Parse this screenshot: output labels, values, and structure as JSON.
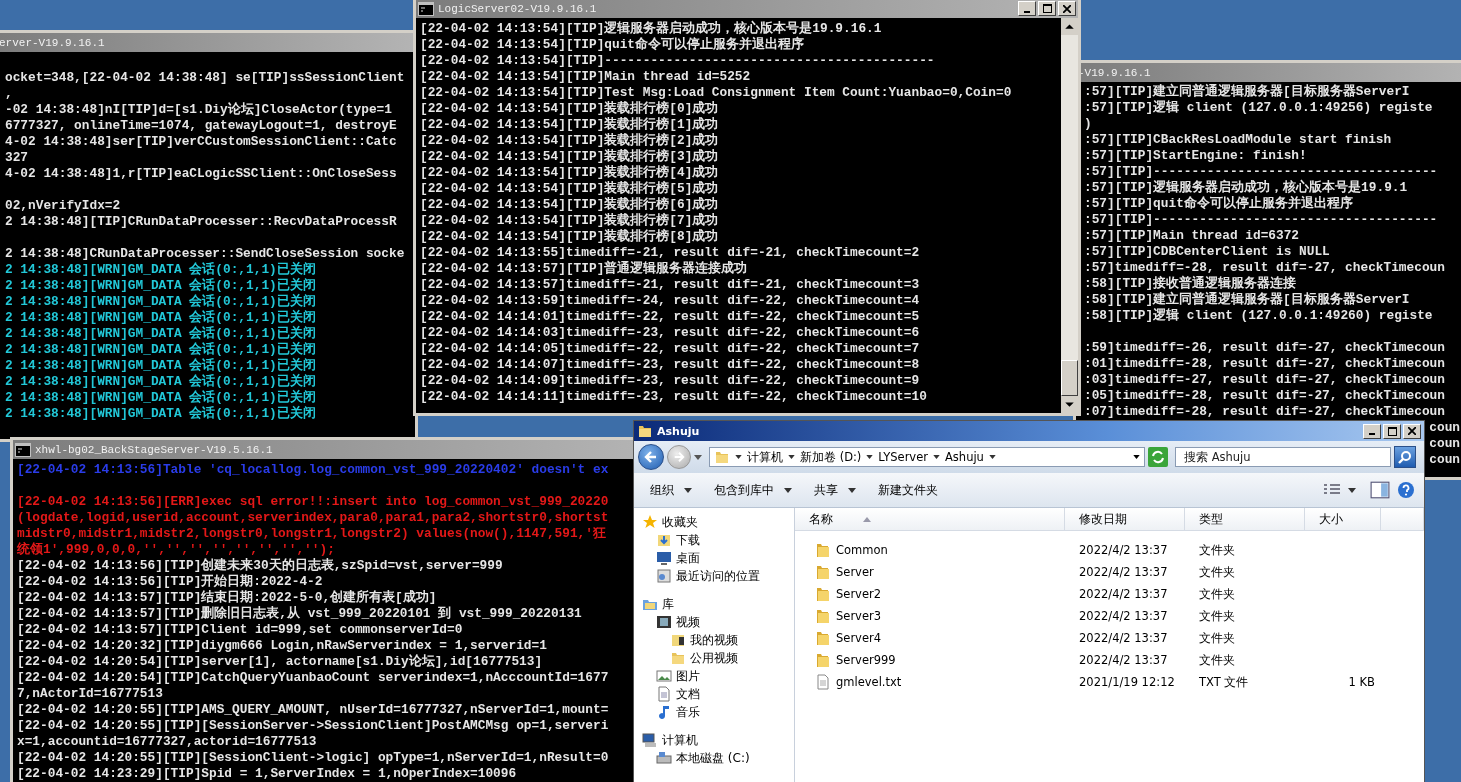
{
  "console_windows": [
    {
      "title": "erver-V19.9.16.1",
      "lines": [
        {
          "kind": "blank"
        },
        {
          "kind": "tip",
          "text": "ocket=348,[22-04-02 14:38:48] se[TIP]ssSessionClient"
        },
        {
          "kind": "tip",
          "text": ","
        },
        {
          "kind": "tip",
          "text": "-02 14:38:48]nI[TIP]d=[s1.Diy论坛]CloseActor(type=1"
        },
        {
          "kind": "tip",
          "text": "6777327, onlineTime=1074, gatewayLogout=1, destroyE"
        },
        {
          "kind": "tip",
          "text": "4-02 14:38:48]ser[TIP]verCCustomSessionClient::Catc"
        },
        {
          "kind": "tip",
          "text": "327"
        },
        {
          "kind": "tip",
          "text": "4-02 14:38:48]1,r[TIP]eaCLogicSSClient::OnCloseSess"
        },
        {
          "kind": "blank"
        },
        {
          "kind": "tip",
          "text": "02,nVerifyIdx=2"
        },
        {
          "kind": "tip",
          "text": "2 14:38:48][TIP]CRunDataProcesser::RecvDataProcessR"
        },
        {
          "kind": "blank"
        },
        {
          "kind": "tip",
          "text": "2 14:38:48]CRunDataProcesser::SendCloseSession socke"
        },
        {
          "kind": "warn",
          "text": "2 14:38:48][WRN]GM_DATA 会话(0:,1,1)已关闭"
        },
        {
          "kind": "warn",
          "text": "2 14:38:48][WRN]GM_DATA 会话(0:,1,1)已关闭"
        },
        {
          "kind": "warn",
          "text": "2 14:38:48][WRN]GM_DATA 会话(0:,1,1)已关闭"
        },
        {
          "kind": "warn",
          "text": "2 14:38:48][WRN]GM_DATA 会话(0:,1,1)已关闭"
        },
        {
          "kind": "warn",
          "text": "2 14:38:48][WRN]GM_DATA 会话(0:,1,1)已关闭"
        },
        {
          "kind": "warn",
          "text": "2 14:38:48][WRN]GM_DATA 会话(0:,1,1)已关闭"
        },
        {
          "kind": "warn",
          "text": "2 14:38:48][WRN]GM_DATA 会话(0:,1,1)已关闭"
        },
        {
          "kind": "warn",
          "text": "2 14:38:48][WRN]GM_DATA 会话(0:,1,1)已关闭"
        },
        {
          "kind": "warn",
          "text": "2 14:38:48][WRN]GM_DATA 会话(0:,1,1)已关闭"
        },
        {
          "kind": "warn",
          "text": "2 14:38:48][WRN]GM_DATA 会话(0:,1,1)已关闭"
        }
      ]
    },
    {
      "title": "-V19.9.16.1",
      "lines": [
        {
          "kind": "tip",
          "text": ":57][TIP]建立同普通逻辑服务器[目标服务器ServerI"
        },
        {
          "kind": "tip",
          "text": ":57][TIP]逻辑 client (127.0.0.1:49256) registe"
        },
        {
          "kind": "tip",
          "text": ")"
        },
        {
          "kind": "tip",
          "text": ":57][TIP]CBackResLoadModule start finish"
        },
        {
          "kind": "tip",
          "text": ":57][TIP]StartEngine: finish!"
        },
        {
          "kind": "tip",
          "text": ":57][TIP]-------------------------------------"
        },
        {
          "kind": "tip",
          "text": ":57][TIP]逻辑服务器启动成功，核心版本号是19.9.1"
        },
        {
          "kind": "tip",
          "text": ":57][TIP]quit命令可以停止服务并退出程序"
        },
        {
          "kind": "tip",
          "text": ":57][TIP]-------------------------------------"
        },
        {
          "kind": "tip",
          "text": ":57][TIP]Main thread id=6372"
        },
        {
          "kind": "tip",
          "text": ":57][TIP]CDBCenterClient is NULL"
        },
        {
          "kind": "tip",
          "text": ":57]timediff=-28, result dif=-27, checkTimecoun"
        },
        {
          "kind": "tip",
          "text": ":58][TIP]接收普通逻辑服务器连接"
        },
        {
          "kind": "tip",
          "text": ":58][TIP]建立同普通逻辑服务器[目标服务器ServerI"
        },
        {
          "kind": "tip",
          "text": ":58][TIP]逻辑 client (127.0.0.1:49260) registe"
        },
        {
          "kind": "blank"
        },
        {
          "kind": "tip",
          "text": ":59]timediff=-26, result dif=-27, checkTimecoun"
        },
        {
          "kind": "tip",
          "text": ":01]timediff=-28, result dif=-27, checkTimecoun"
        },
        {
          "kind": "tip",
          "text": ":03]timediff=-27, result dif=-27, checkTimecoun"
        },
        {
          "kind": "tip",
          "text": ":05]timediff=-28, result dif=-27, checkTimecoun"
        },
        {
          "kind": "tip",
          "text": ":07]timediff=-28, result dif=-27, checkTimecoun"
        },
        {
          "kind": "tail",
          "text": "coun"
        },
        {
          "kind": "tail",
          "text": "coun"
        },
        {
          "kind": "tail",
          "text": "coun"
        }
      ]
    },
    {
      "title": "LogicServer02-V19.9.16.1",
      "lines": [
        {
          "kind": "tip",
          "text": "[22-04-02 14:13:54][TIP]逻辑服务器启动成功，核心版本号是19.9.16.1"
        },
        {
          "kind": "tip",
          "text": "[22-04-02 14:13:54][TIP]quit命令可以停止服务并退出程序"
        },
        {
          "kind": "tip",
          "text": "[22-04-02 14:13:54][TIP]-------------------------------------------"
        },
        {
          "kind": "tip",
          "text": "[22-04-02 14:13:54][TIP]Main thread id=5252"
        },
        {
          "kind": "tip",
          "text": "[22-04-02 14:13:54][TIP]Test Msg:Load Consignment Item Count:Yuanbao=0,Coin=0"
        },
        {
          "kind": "tip",
          "text": "[22-04-02 14:13:54][TIP]装载排行榜[0]成功"
        },
        {
          "kind": "tip",
          "text": "[22-04-02 14:13:54][TIP]装载排行榜[1]成功"
        },
        {
          "kind": "tip",
          "text": "[22-04-02 14:13:54][TIP]装载排行榜[2]成功"
        },
        {
          "kind": "tip",
          "text": "[22-04-02 14:13:54][TIP]装载排行榜[3]成功"
        },
        {
          "kind": "tip",
          "text": "[22-04-02 14:13:54][TIP]装载排行榜[4]成功"
        },
        {
          "kind": "tip",
          "text": "[22-04-02 14:13:54][TIP]装载排行榜[5]成功"
        },
        {
          "kind": "tip",
          "text": "[22-04-02 14:13:54][TIP]装载排行榜[6]成功"
        },
        {
          "kind": "tip",
          "text": "[22-04-02 14:13:54][TIP]装载排行榜[7]成功"
        },
        {
          "kind": "tip",
          "text": "[22-04-02 14:13:54][TIP]装载排行榜[8]成功"
        },
        {
          "kind": "tip",
          "text": "[22-04-02 14:13:55]timediff=-21, result dif=-21, checkTimecount=2"
        },
        {
          "kind": "tip",
          "text": "[22-04-02 14:13:57][TIP]普通逻辑服务器连接成功"
        },
        {
          "kind": "tip",
          "text": "[22-04-02 14:13:57]timediff=-21, result dif=-21, checkTimecount=3"
        },
        {
          "kind": "tip",
          "text": "[22-04-02 14:13:59]timediff=-24, result dif=-22, checkTimecount=4"
        },
        {
          "kind": "tip",
          "text": "[22-04-02 14:14:01]timediff=-22, result dif=-22, checkTimecount=5"
        },
        {
          "kind": "tip",
          "text": "[22-04-02 14:14:03]timediff=-23, result dif=-22, checkTimecount=6"
        },
        {
          "kind": "tip",
          "text": "[22-04-02 14:14:05]timediff=-22, result dif=-22, checkTimecount=7"
        },
        {
          "kind": "tip",
          "text": "[22-04-02 14:14:07]timediff=-23, result dif=-22, checkTimecount=8"
        },
        {
          "kind": "tip",
          "text": "[22-04-02 14:14:09]timediff=-23, result dif=-22, checkTimecount=9"
        },
        {
          "kind": "tip",
          "text": "[22-04-02 14:14:11]timediff=-23, result dif=-22, checkTimecount=10"
        }
      ]
    },
    {
      "title": "xhwl-bg02_BackStageServer-V19.5.16.1",
      "lines": [
        {
          "kind": "sql",
          "text": "[22-04-02 14:13:56]Table 'cq_locallog.log_common_vst_999_20220402' doesn't ex"
        },
        {
          "kind": "blank"
        },
        {
          "kind": "error",
          "text": "[22-04-02 14:13:56][ERR]exec sql error!!:insert into log_common_vst_999_20220"
        },
        {
          "kind": "error",
          "text": "(logdate,logid,userid,account,serverindex,para0,para1,para2,shortstr0,shortst"
        },
        {
          "kind": "error",
          "text": "midstr0,midstr1,midstr2,longstr0,longstr1,longstr2) values(now(),1147,591,'狂"
        },
        {
          "kind": "error",
          "text": "统领1',999,0,0,0,'','','','','','','','');"
        },
        {
          "kind": "tip",
          "text": "[22-04-02 14:13:56][TIP]创建未来30天的日志表,szSpid=vst,server=999"
        },
        {
          "kind": "tip",
          "text": "[22-04-02 14:13:56][TIP]开始日期:2022-4-2"
        },
        {
          "kind": "tip",
          "text": "[22-04-02 14:13:57][TIP]结束日期:2022-5-0,创建所有表[成功]"
        },
        {
          "kind": "tip",
          "text": "[22-04-02 14:13:57][TIP]删除旧日志表,从 vst_999_20220101 到 vst_999_20220131"
        },
        {
          "kind": "tip",
          "text": "[22-04-02 14:13:57][TIP]Client id=999,set commonserverId=0"
        },
        {
          "kind": "tip",
          "text": "[22-04-02 14:20:32][TIP]diygm666 Login,nRawServerindex = 1,serverid=1"
        },
        {
          "kind": "tip",
          "text": "[22-04-02 14:20:54][TIP]server[1], actorname[s1.Diy论坛],id[16777513]"
        },
        {
          "kind": "tip",
          "text": "[22-04-02 14:20:54][TIP]CatchQueryYuanbaoCount serverindex=1,nAcccountId=1677"
        },
        {
          "kind": "tip",
          "text": "7,nActorId=16777513"
        },
        {
          "kind": "tip",
          "text": "[22-04-02 14:20:55][TIP]AMS_QUERY_AMOUNT, nUserId=16777327,nServerId=1,mount="
        },
        {
          "kind": "tip",
          "text": "[22-04-02 14:20:55][TIP][SessionServer->SessionClient]PostAMCMsg op=1,serveri"
        },
        {
          "kind": "tip",
          "text": "x=1,accountid=16777327,actorid=16777513"
        },
        {
          "kind": "tip",
          "text": "[22-04-02 14:20:55][TIP][SessionClient->logic] opType=1,nServerId=1,nResult=0"
        },
        {
          "kind": "tip",
          "text": "[22-04-02 14:23:29][TIP]Spid = 1,ServerIndex = 1,nOperIndex=10096"
        }
      ]
    }
  ],
  "explorer": {
    "title": "Ashuju",
    "address": [
      "计算机",
      "新加卷 (D:)",
      "LYServer",
      "Ashuju"
    ],
    "search": {
      "placeholder": "搜索 Ashuju"
    },
    "toolbar": [
      {
        "label": "组织",
        "dropdown": true
      },
      {
        "label": "包含到库中",
        "dropdown": true
      },
      {
        "label": "共享",
        "dropdown": true
      },
      {
        "label": "新建文件夹",
        "dropdown": false
      }
    ],
    "nav": [
      {
        "label": "收藏夹",
        "kind": "star",
        "children": [
          {
            "label": "下载",
            "kind": "download"
          },
          {
            "label": "桌面",
            "kind": "desktop"
          },
          {
            "label": "最近访问的位置",
            "kind": "recent"
          }
        ]
      },
      {
        "label": "库",
        "kind": "library",
        "children": [
          {
            "label": "视频",
            "kind": "video",
            "children": [
              {
                "label": "我的视频",
                "kind": "videofolder"
              },
              {
                "label": "公用视频",
                "kind": "folder"
              }
            ]
          },
          {
            "label": "图片",
            "kind": "picture"
          },
          {
            "label": "文档",
            "kind": "document"
          },
          {
            "label": "音乐",
            "kind": "music"
          }
        ]
      },
      {
        "label": "计算机",
        "kind": "computer",
        "children": [
          {
            "label": "本地磁盘 (C:)",
            "kind": "disk"
          }
        ]
      }
    ],
    "columns": [
      {
        "label": "名称",
        "sorted": true
      },
      {
        "label": "修改日期",
        "sorted": false
      },
      {
        "label": "类型",
        "sorted": false
      },
      {
        "label": "大小",
        "sorted": false
      }
    ],
    "rows": [
      {
        "kind": "folder",
        "name": "Common",
        "date": "2022/4/2 13:37",
        "type": "文件夹"
      },
      {
        "kind": "folder",
        "name": "Server",
        "date": "2022/4/2 13:37",
        "type": "文件夹"
      },
      {
        "kind": "folder",
        "name": "Server2",
        "date": "2022/4/2 13:37",
        "type": "文件夹"
      },
      {
        "kind": "folder",
        "name": "Server3",
        "date": "2022/4/2 13:37",
        "type": "文件夹"
      },
      {
        "kind": "folder",
        "name": "Server4",
        "date": "2022/4/2 13:37",
        "type": "文件夹"
      },
      {
        "kind": "folder",
        "name": "Server999",
        "date": "2022/4/2 13:37",
        "type": "文件夹"
      },
      {
        "kind": "file",
        "name": "gmlevel.txt",
        "date": "2021/1/19 12:12",
        "type": "TXT 文件",
        "size": "1 KB"
      }
    ]
  }
}
